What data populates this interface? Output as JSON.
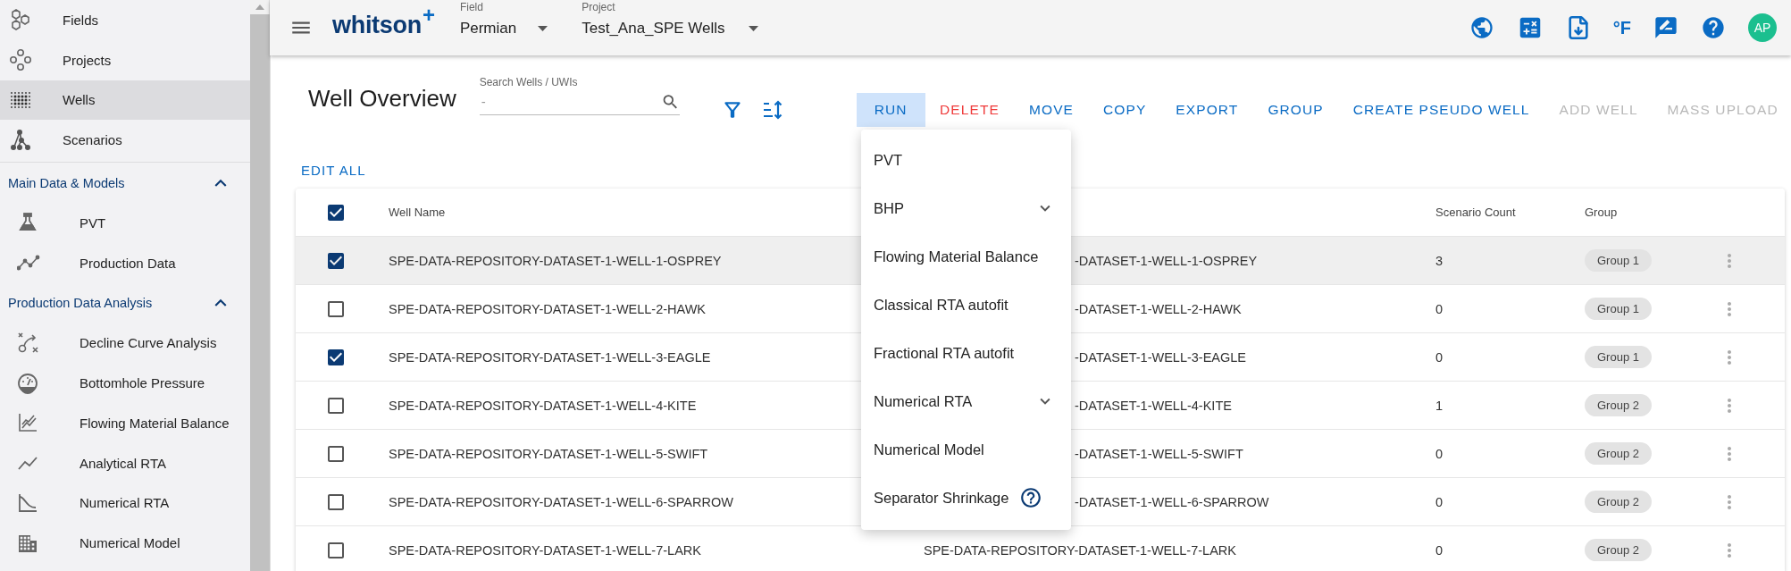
{
  "sidebar": {
    "nav_items": [
      {
        "label": "Fields",
        "selected": false
      },
      {
        "label": "Projects",
        "selected": false
      },
      {
        "label": "Wells",
        "selected": true
      },
      {
        "label": "Scenarios",
        "selected": false
      }
    ],
    "sections": [
      {
        "title": "Main Data & Models",
        "expanded": true,
        "items": [
          {
            "label": "PVT"
          },
          {
            "label": "Production Data"
          }
        ]
      },
      {
        "title": "Production Data Analysis",
        "expanded": true,
        "items": [
          {
            "label": "Decline Curve Analysis"
          },
          {
            "label": "Bottomhole Pressure"
          },
          {
            "label": "Flowing Material Balance"
          },
          {
            "label": "Analytical RTA"
          },
          {
            "label": "Numerical RTA"
          },
          {
            "label": "Numerical Model"
          }
        ]
      }
    ]
  },
  "top_bar": {
    "logo": "whitson",
    "logo_mark": "+",
    "selectors": [
      {
        "label": "Field",
        "value": "Permian"
      },
      {
        "label": "Project",
        "value": "Test_Ana_SPE Wells"
      }
    ],
    "temperature_unit": "°F",
    "avatar": "AP"
  },
  "page": {
    "title": "Well Overview",
    "search": {
      "label": "Search Wells / UWIs",
      "placeholder": "-"
    },
    "actions": [
      {
        "label": "RUN",
        "kind": "primary",
        "selected": true,
        "disabled": false
      },
      {
        "label": "DELETE",
        "kind": "danger",
        "selected": false,
        "disabled": false
      },
      {
        "label": "MOVE",
        "kind": "primary",
        "selected": false,
        "disabled": false
      },
      {
        "label": "COPY",
        "kind": "primary",
        "selected": false,
        "disabled": false
      },
      {
        "label": "EXPORT",
        "kind": "primary",
        "selected": false,
        "disabled": false
      },
      {
        "label": "GROUP",
        "kind": "primary",
        "selected": false,
        "disabled": false
      },
      {
        "label": "CREATE PSEUDO WELL",
        "kind": "primary",
        "selected": false,
        "disabled": false
      },
      {
        "label": "ADD WELL",
        "kind": "primary",
        "selected": false,
        "disabled": true
      },
      {
        "label": "MASS UPLOAD",
        "kind": "primary",
        "selected": false,
        "disabled": true
      }
    ],
    "edit_all": "EDIT ALL"
  },
  "run_menu": [
    {
      "label": "PVT",
      "kind": "plain"
    },
    {
      "label": "BHP",
      "kind": "expandable"
    },
    {
      "label": "Flowing Material Balance",
      "kind": "plain"
    },
    {
      "label": "Classical RTA autofit",
      "kind": "plain"
    },
    {
      "label": "Fractional RTA autofit",
      "kind": "plain"
    },
    {
      "label": "Numerical RTA",
      "kind": "expandable"
    },
    {
      "label": "Numerical Model",
      "kind": "plain"
    },
    {
      "label": "Separator Shrinkage",
      "kind": "help"
    }
  ],
  "table": {
    "select_all_checked": true,
    "columns": [
      "Well Name",
      "Scenario Count",
      "Group"
    ],
    "rows": [
      {
        "checked": true,
        "selected": true,
        "well_name": "SPE-DATA-REPOSITORY-DATASET-1-WELL-1-OSPREY",
        "column_2": "-DATASET-1-WELL-1-OSPREY",
        "scenario_count": "3",
        "group": "Group 1"
      },
      {
        "checked": false,
        "selected": false,
        "well_name": "SPE-DATA-REPOSITORY-DATASET-1-WELL-2-HAWK",
        "column_2": "-DATASET-1-WELL-2-HAWK",
        "scenario_count": "0",
        "group": "Group 1"
      },
      {
        "checked": true,
        "selected": false,
        "well_name": "SPE-DATA-REPOSITORY-DATASET-1-WELL-3-EAGLE",
        "column_2": "-DATASET-1-WELL-3-EAGLE",
        "scenario_count": "0",
        "group": "Group 1"
      },
      {
        "checked": false,
        "selected": false,
        "well_name": "SPE-DATA-REPOSITORY-DATASET-1-WELL-4-KITE",
        "column_2": "-DATASET-1-WELL-4-KITE",
        "scenario_count": "1",
        "group": "Group 2"
      },
      {
        "checked": false,
        "selected": false,
        "well_name": "SPE-DATA-REPOSITORY-DATASET-1-WELL-5-SWIFT",
        "column_2": "-DATASET-1-WELL-5-SWIFT",
        "scenario_count": "0",
        "group": "Group 2"
      },
      {
        "checked": false,
        "selected": false,
        "well_name": "SPE-DATA-REPOSITORY-DATASET-1-WELL-6-SPARROW",
        "column_2": "-DATASET-1-WELL-6-SPARROW",
        "scenario_count": "0",
        "group": "Group 2"
      },
      {
        "checked": false,
        "selected": false,
        "well_name": "SPE-DATA-REPOSITORY-DATASET-1-WELL-7-LARK",
        "column_2": "SPE-DATA-REPOSITORY-DATASET-1-WELL-7-LARK",
        "scenario_count": "0",
        "group": "Group 2"
      }
    ]
  }
}
